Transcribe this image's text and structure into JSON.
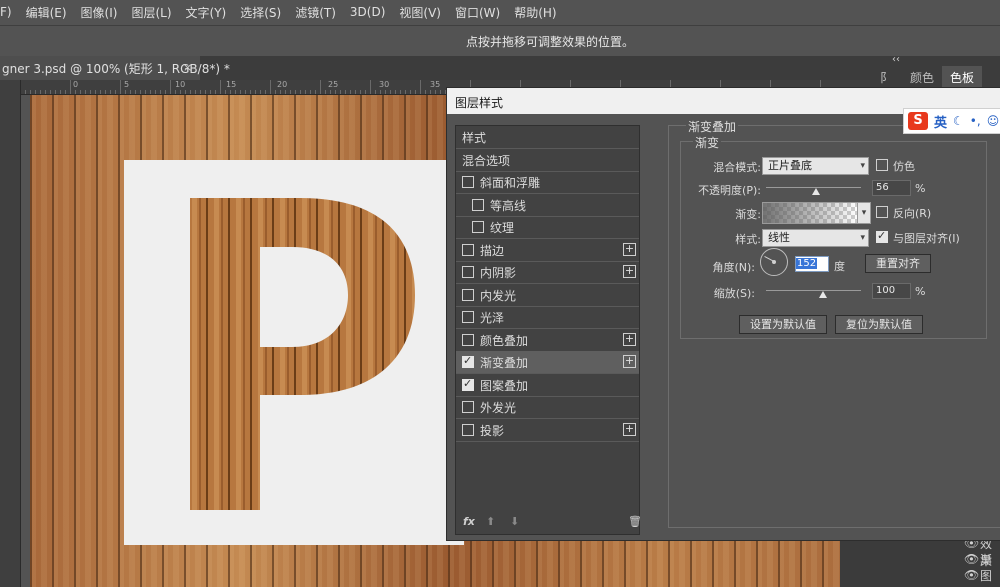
{
  "menu": [
    "F)",
    "编辑(E)",
    "图像(I)",
    "图层(L)",
    "文字(Y)",
    "选择(S)",
    "滤镜(T)",
    "3D(D)",
    "视图(V)",
    "窗口(W)",
    "帮助(H)"
  ],
  "options_hint": "点按并拖移可调整效果的位置。",
  "document_tab": {
    "label": "gner 3.psd @ 100% (矩形 1, RGB/8*) *",
    "close": "×"
  },
  "ruler_labels": [
    "0",
    "5",
    "10",
    "15",
    "20",
    "25",
    "30",
    "35"
  ],
  "right_panel": {
    "collapse": "‹‹",
    "tabs": [
      "颜色",
      "色板"
    ],
    "left_partial_tab": "阝",
    "bottom_items": [
      "效果",
      "渐",
      "图"
    ]
  },
  "ime": {
    "s": "S",
    "lang": "英",
    "icons": [
      "☾",
      "•,",
      "☺"
    ]
  },
  "dialog": {
    "title": "图层样式",
    "styles": [
      {
        "label": "样式",
        "checkbox": false,
        "plus": false,
        "indent": 0
      },
      {
        "label": "混合选项",
        "checkbox": false,
        "plus": false,
        "indent": 0
      },
      {
        "label": "斜面和浮雕",
        "checkbox": true,
        "checked": false,
        "plus": false,
        "indent": 0
      },
      {
        "label": "等高线",
        "checkbox": true,
        "checked": false,
        "plus": false,
        "indent": 1
      },
      {
        "label": "纹理",
        "checkbox": true,
        "checked": false,
        "plus": false,
        "indent": 1
      },
      {
        "label": "描边",
        "checkbox": true,
        "checked": false,
        "plus": true,
        "indent": 0
      },
      {
        "label": "内阴影",
        "checkbox": true,
        "checked": false,
        "plus": true,
        "indent": 0
      },
      {
        "label": "内发光",
        "checkbox": true,
        "checked": false,
        "plus": false,
        "indent": 0
      },
      {
        "label": "光泽",
        "checkbox": true,
        "checked": false,
        "plus": false,
        "indent": 0
      },
      {
        "label": "颜色叠加",
        "checkbox": true,
        "checked": false,
        "plus": true,
        "indent": 0
      },
      {
        "label": "渐变叠加",
        "checkbox": true,
        "checked": true,
        "plus": true,
        "indent": 0,
        "active": true
      },
      {
        "label": "图案叠加",
        "checkbox": true,
        "checked": true,
        "plus": false,
        "indent": 0
      },
      {
        "label": "外发光",
        "checkbox": true,
        "checked": false,
        "plus": false,
        "indent": 0
      },
      {
        "label": "投影",
        "checkbox": true,
        "checked": false,
        "plus": true,
        "indent": 0
      }
    ],
    "list_footer": {
      "fx": "fx",
      "up": "⬆",
      "down": "⬇",
      "trash": "🗑"
    },
    "panel": {
      "title": "渐变叠加",
      "subtitle": "渐变",
      "blend_mode_label": "混合模式:",
      "blend_mode_value": "正片叠底",
      "dither_label": "仿色",
      "dither_checked": false,
      "opacity_label": "不透明度(P):",
      "opacity_value": "56",
      "opacity_unit": "%",
      "gradient_label": "渐变:",
      "reverse_label": "反向(R)",
      "reverse_checked": false,
      "style_label": "样式:",
      "style_value": "线性",
      "align_label": "与图层对齐(I)",
      "align_checked": true,
      "angle_label": "角度(N):",
      "angle_value": "152",
      "angle_unit": "度",
      "reset_align_button": "重置对齐",
      "scale_label": "缩放(S):",
      "scale_value": "100",
      "scale_unit": "%",
      "make_default_button": "设置为默认值",
      "reset_default_button": "复位为默认值"
    }
  }
}
